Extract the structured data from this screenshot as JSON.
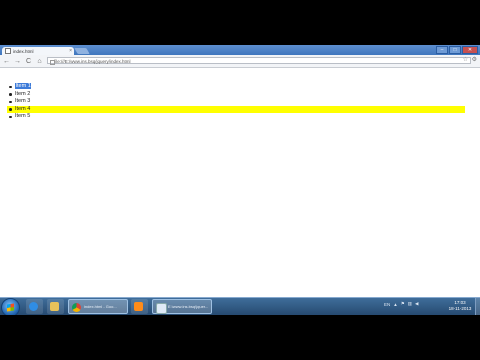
{
  "browser": {
    "tab_title": "index.html",
    "tab_close": "×",
    "window_buttons": [
      "–",
      "□",
      "✕"
    ],
    "nav": {
      "back": "←",
      "forward": "→",
      "reload": "C",
      "home": "⌂"
    },
    "url": "file:///E:/www.ins.bsq/jquery/index.html",
    "star": "☆",
    "wrench": "⚙"
  },
  "page": {
    "items": [
      {
        "label": "Item 1",
        "selected": true,
        "highlighted": false
      },
      {
        "label": "Item 2",
        "selected": false,
        "highlighted": false
      },
      {
        "label": "Item 3",
        "selected": false,
        "highlighted": false
      },
      {
        "label": "Item 4",
        "selected": false,
        "highlighted": true
      },
      {
        "label": "Item 5",
        "selected": false,
        "highlighted": false
      }
    ],
    "highlight_color": "#ffff00",
    "selection_color": "#3d7bd9"
  },
  "taskbar": {
    "chrome_label": "index.html - Goo...",
    "explorer_label": "E:\\www.ins.bsq\\jquer...",
    "tray_lang": "EN",
    "tray_arrow": "▲",
    "clock_time": "17:03",
    "clock_date": "18-11-2013"
  }
}
